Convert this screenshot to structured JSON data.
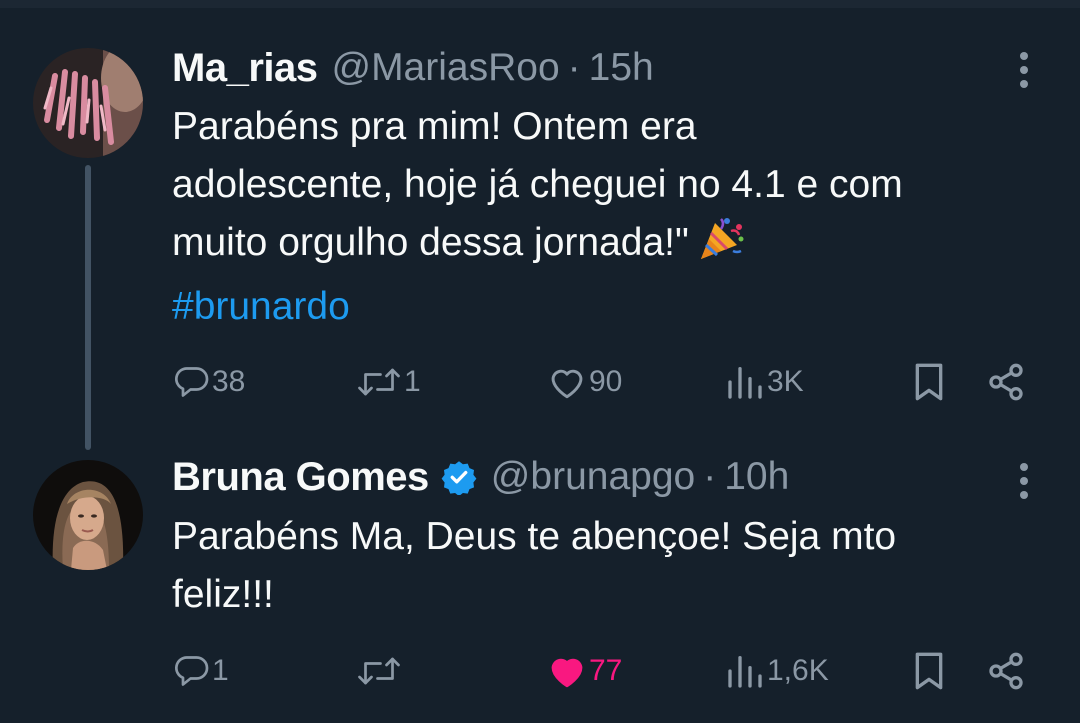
{
  "tweets": [
    {
      "display_name": "Ma_rias",
      "handle": "@MariasRoo",
      "separator": "·",
      "time": "15h",
      "text_lines": [
        "Parabéns pra mim! Ontem era",
        "adolescente, hoje já cheguei no 4.1 e com",
        "muito orgulho dessa jornada!\""
      ],
      "emoji": "🎉",
      "hashtag": "#brunardo",
      "replies": "38",
      "retweets": "1",
      "likes": "90",
      "views": "3K",
      "verified": false,
      "liked": false
    },
    {
      "display_name": "Bruna Gomes",
      "handle": "@brunapgo",
      "separator": "·",
      "time": "10h",
      "text_lines": [
        "Parabéns Ma, Deus te abençoe! Seja mto",
        "feliz!!!"
      ],
      "replies": "1",
      "retweets": "",
      "likes": "77",
      "views": "1,6K",
      "verified": true,
      "liked": true
    }
  ],
  "icons": {
    "more": "more-vertical-icon",
    "reply": "reply-icon",
    "retweet": "retweet-icon",
    "like": "heart-icon",
    "views": "views-icon",
    "bookmark": "bookmark-icon",
    "share": "share-icon",
    "verified": "verified-badge-icon",
    "party": "party-popper-icon"
  },
  "colors": {
    "background": "#15202b",
    "text": "#f7f9f9",
    "muted": "#8b98a5",
    "link": "#1d9bf0",
    "like": "#f91880",
    "verified": "#1d9bf0",
    "thread_line": "#425364"
  }
}
